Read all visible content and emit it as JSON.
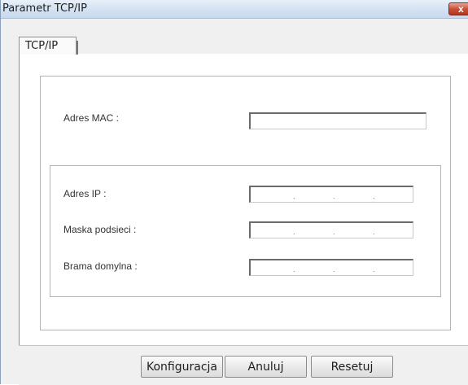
{
  "window": {
    "title": "Parametr TCP/IP",
    "close_label": "x"
  },
  "tabs": [
    {
      "label": "TCP/IP",
      "active": true
    }
  ],
  "form": {
    "mac": {
      "label": "Adres MAC :",
      "value": ""
    },
    "ip": {
      "label": "Adres IP :",
      "value": "",
      "separators": [
        ".",
        ".",
        "."
      ]
    },
    "mask": {
      "label": "Maska podsieci :",
      "value": "",
      "separators": [
        ".",
        ".",
        "."
      ]
    },
    "gateway": {
      "label": "Brama domylna :",
      "value": "",
      "separators": [
        ".",
        ".",
        "."
      ]
    }
  },
  "buttons": {
    "configure": "Konfiguracja",
    "cancel": "Anuluj",
    "reset": "Resetuj"
  },
  "colors": {
    "titlebar": "#d4e1f1",
    "close_button": "#c7503a",
    "ip_separator": "#d24b4b"
  }
}
